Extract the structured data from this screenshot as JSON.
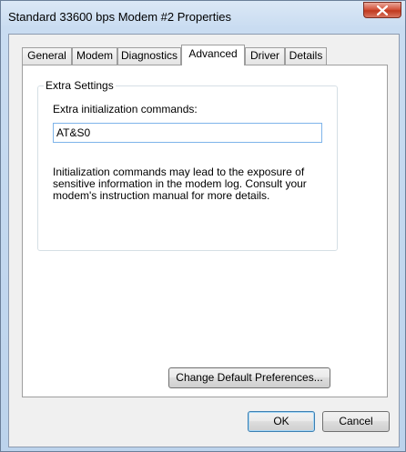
{
  "window": {
    "title": "Standard 33600 bps Modem #2 Properties"
  },
  "tabs": [
    {
      "label": "General",
      "active": false
    },
    {
      "label": "Modem",
      "active": false
    },
    {
      "label": "Diagnostics",
      "active": false
    },
    {
      "label": "Advanced",
      "active": true
    },
    {
      "label": "Driver",
      "active": false
    },
    {
      "label": "Details",
      "active": false
    }
  ],
  "advanced": {
    "group_title": "Extra Settings",
    "init_label": "Extra initialization commands:",
    "init_value": "AT&S0",
    "info_text": "Initialization commands may lead to the exposure of sensitive information in the modem log. Consult your modem's instruction manual for more details.",
    "change_prefs_label": "Change Default Preferences..."
  },
  "buttons": {
    "ok": "OK",
    "cancel": "Cancel"
  },
  "colors": {
    "close_button": "#c9452d",
    "textbox_border": "#7eb4ea",
    "default_button_border": "#3c7fb1"
  },
  "icons": [
    "close-icon"
  ]
}
